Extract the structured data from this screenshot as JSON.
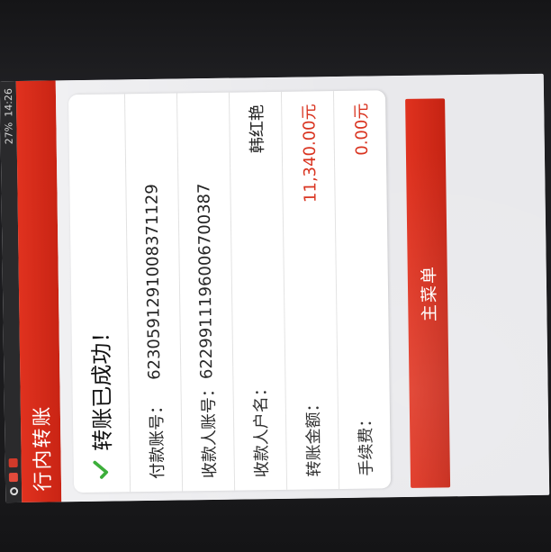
{
  "statusbar": {
    "time": "14:26",
    "battery": "27%",
    "icons": [
      "search-icon",
      "weibo-icon",
      "mail-icon"
    ]
  },
  "title": "行内转账",
  "success_message": "转账已成功！",
  "rows": [
    {
      "label": "付款账号：",
      "value": "6230591291008371129"
    },
    {
      "label": "收款人账号：",
      "value": "6229911196006700387"
    },
    {
      "label": "收款人户名：",
      "value": "韩红艳"
    },
    {
      "label": "转账金额：",
      "value": "11,340.00元"
    },
    {
      "label": "手续费：",
      "value": "0.00元"
    }
  ],
  "main_menu_label": "主菜单",
  "colors": {
    "brand_red": "#d9331f",
    "check_green": "#3cae3a"
  }
}
